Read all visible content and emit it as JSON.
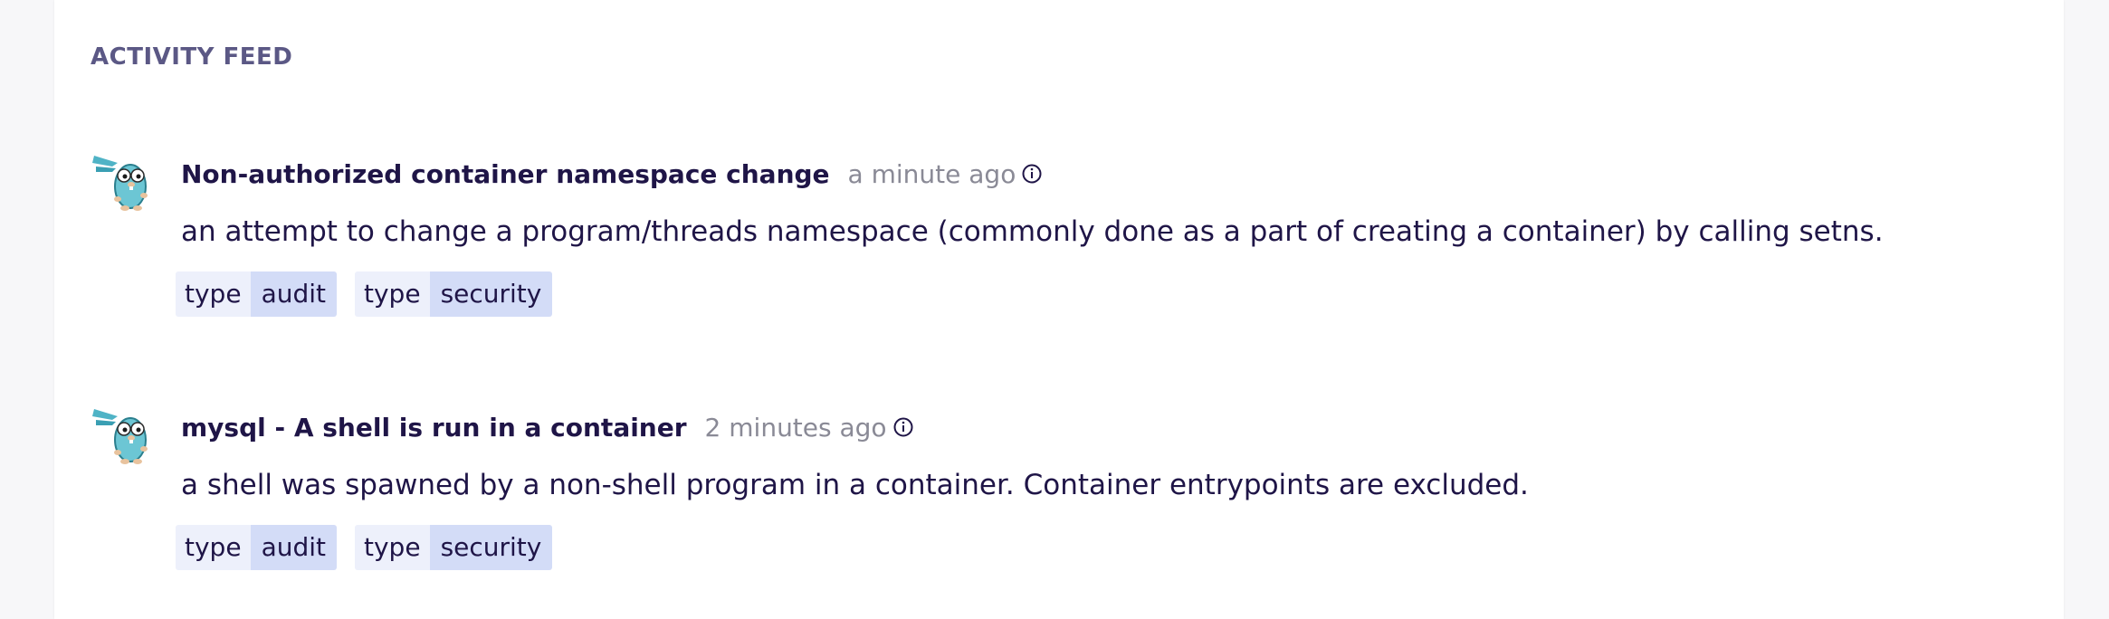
{
  "feed": {
    "title": "ACTIVITY FEED",
    "items": [
      {
        "avatar_icon": "gopher-mascot-icon",
        "title": "Non-authorized container namespace change",
        "time": "a minute ago",
        "description": "an attempt to change a program/threads namespace (commonly done as a part of creating a container) by calling setns.",
        "tags": [
          {
            "key": "type",
            "value": "audit"
          },
          {
            "key": "type",
            "value": "security"
          }
        ]
      },
      {
        "avatar_icon": "gopher-mascot-icon",
        "title": "mysql - A shell is run in a container",
        "time": "2 minutes ago",
        "description": "a shell was spawned by a non-shell program in a container. Container entrypoints are excluded.",
        "tags": [
          {
            "key": "type",
            "value": "audit"
          },
          {
            "key": "type",
            "value": "security"
          }
        ]
      }
    ]
  },
  "colors": {
    "title_text": "#1f1547",
    "muted_text": "#8a8a96",
    "section_heading": "#5b5885",
    "tag_key_bg": "#edf0fb",
    "tag_value_bg": "#d3dcf7",
    "avatar_teal": "#4fb3c6"
  }
}
